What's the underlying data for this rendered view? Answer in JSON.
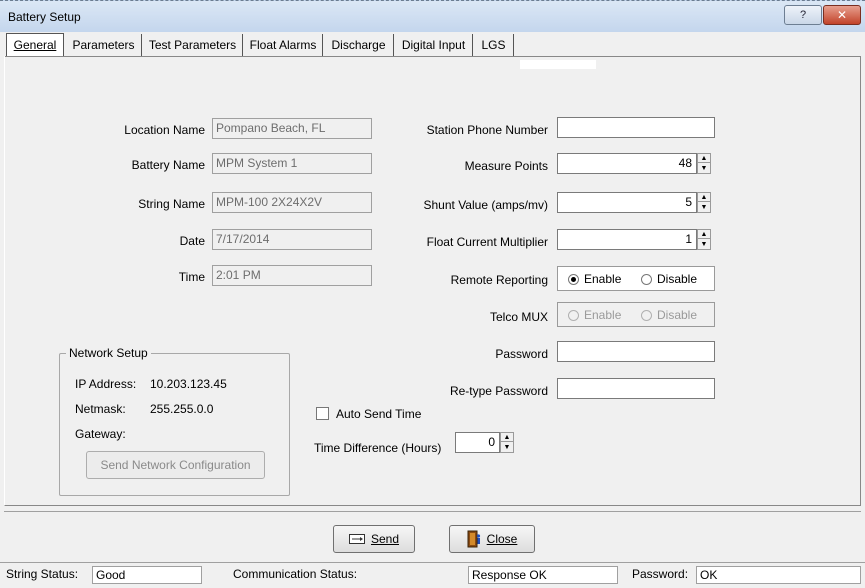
{
  "window": {
    "title": "Battery Setup"
  },
  "title_buttons": {
    "help": "?",
    "close": "✕"
  },
  "tabs": [
    {
      "label": "General"
    },
    {
      "label": "Parameters"
    },
    {
      "label": "Test Parameters"
    },
    {
      "label": "Float Alarms"
    },
    {
      "label": "Discharge"
    },
    {
      "label": "Digital Input"
    },
    {
      "label": "LGS"
    }
  ],
  "left_fields": {
    "location_label": "Location Name",
    "location_value": "Pompano Beach, FL",
    "battery_label": "Battery Name",
    "battery_value": "MPM System 1",
    "string_label": "String Name",
    "string_value": "MPM-100 2X24X2V",
    "date_label": "Date",
    "date_value": "7/17/2014",
    "time_label": "Time",
    "time_value": "2:01 PM"
  },
  "right_fields": {
    "phone_label": "Station Phone Number",
    "phone_value": "",
    "measure_label": "Measure Points",
    "measure_value": "48",
    "shunt_label": "Shunt Value (amps/mv)",
    "shunt_value": "5",
    "float_label": "Float Current Multiplier",
    "float_value": "1",
    "remote_label": "Remote Reporting",
    "remote_enable": "Enable",
    "remote_disable": "Disable",
    "remote_selected": "Enable",
    "telco_label": "Telco MUX",
    "telco_enable": "Enable",
    "telco_disable": "Disable",
    "password_label": "Password",
    "password_value": "",
    "retype_label": "Re-type Password",
    "retype_value": ""
  },
  "network": {
    "legend": "Network Setup",
    "ip_label": "IP Address:",
    "ip_value": "10.203.123.45",
    "netmask_label": "Netmask:",
    "netmask_value": "255.255.0.0",
    "gateway_label": "Gateway:",
    "gateway_value": "",
    "send_config_label": "Send Network Configuration"
  },
  "auto_send": {
    "label": "Auto Send Time",
    "checked": false
  },
  "time_diff": {
    "label": "Time Difference (Hours)",
    "value": "0"
  },
  "buttons": {
    "send": "Send",
    "close": "Close"
  },
  "statusbar": {
    "string_status_label": "String Status:",
    "string_status_value": "Good",
    "comm_status_label": "Communication Status:",
    "comm_status_value": "Response OK",
    "password_label": "Password:",
    "password_value": "OK"
  }
}
